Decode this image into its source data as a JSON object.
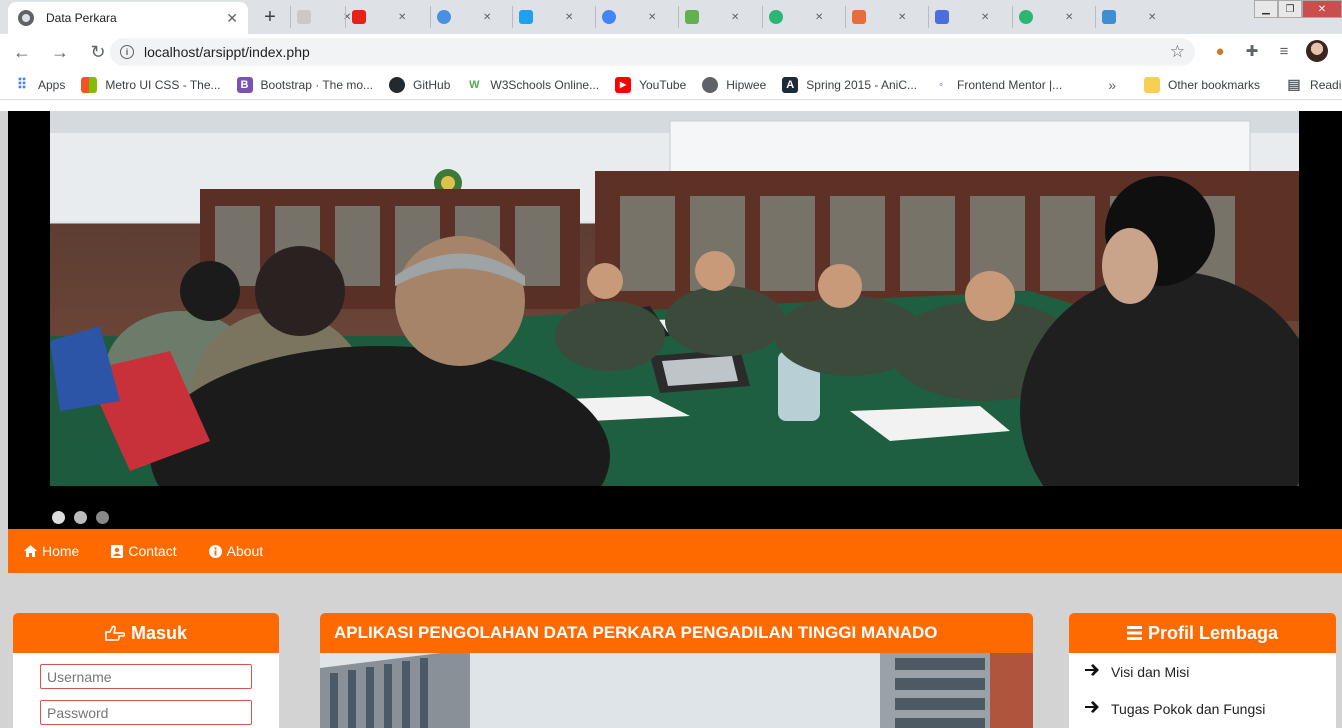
{
  "browser": {
    "active_tab_title": "Data Perkara",
    "url": "localhost/arsippt/index.php",
    "bookmarks": [
      {
        "label": "Apps",
        "icon": "apps-grid-icon"
      },
      {
        "label": "Metro UI CSS - The...",
        "icon": "windows-logo-icon"
      },
      {
        "label": "Bootstrap · The mo...",
        "icon": "bootstrap-icon"
      },
      {
        "label": "GitHub",
        "icon": "github-icon"
      },
      {
        "label": "W3Schools Online...",
        "icon": "w3schools-icon"
      },
      {
        "label": "YouTube",
        "icon": "youtube-icon"
      },
      {
        "label": "Hipwee",
        "icon": "globe-icon"
      },
      {
        "label": "Spring 2015 - AniC...",
        "icon": "anichart-icon"
      },
      {
        "label": "Frontend Mentor |...",
        "icon": "frontend-mentor-icon"
      }
    ],
    "bookmarks_more": "»",
    "other_bookmarks": "Other bookmarks",
    "reading_list": "Reading li"
  },
  "carousel": {
    "slide_count": 3,
    "active_index": 0
  },
  "nav": {
    "home": "Home",
    "contact": "Contact",
    "about": "About"
  },
  "login": {
    "title": "Masuk",
    "username_placeholder": "Username",
    "password_placeholder": "Password"
  },
  "main": {
    "title": "APLIKASI PENGOLAHAN DATA PERKARA PENGADILAN TINGGI MANADO"
  },
  "profil": {
    "title": "Profil Lembaga",
    "items": [
      "Visi dan Misi",
      "Tugas Pokok dan Fungsi"
    ]
  },
  "colors": {
    "accent": "#ff6a00",
    "page_bg": "#d3d3d3",
    "input_border": "#d9534f"
  }
}
